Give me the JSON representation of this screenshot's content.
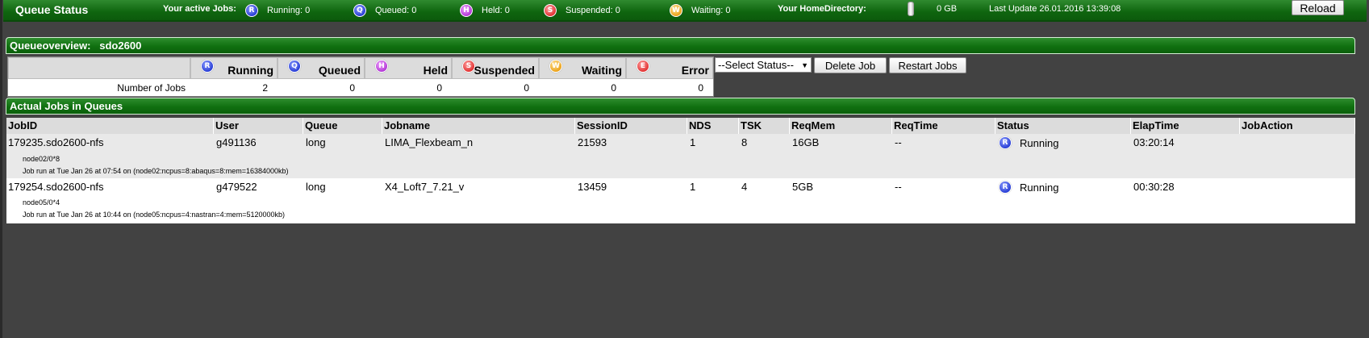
{
  "topbar": {
    "title": "Queue Status",
    "active_jobs_label": "Your active Jobs:",
    "counts": [
      {
        "badge": "R",
        "text": "Running: 0",
        "color": "#2a3fd6"
      },
      {
        "badge": "Q",
        "text": "Queued: 0",
        "color": "#2a3fd6"
      },
      {
        "badge": "H",
        "text": "Held: 0",
        "color": "#b43ad6"
      },
      {
        "badge": "S",
        "text": "Suspended: 0",
        "color": "#e23434"
      },
      {
        "badge": "W",
        "text": "Waiting: 0",
        "color": "#eba21a"
      }
    ],
    "home_dir_label": "Your HomeDirectory:",
    "home_dir_size": "0 GB",
    "last_update": "Last Update 26.01.2016 13:39:08",
    "reload_label": "Reload"
  },
  "overview": {
    "title": "Queueoverview:   sdo2600",
    "columns": [
      {
        "badge": "R",
        "label": "Running"
      },
      {
        "badge": "Q",
        "label": "Queued"
      },
      {
        "badge": "H",
        "label": "Held"
      },
      {
        "badge": "S",
        "label": "Suspended"
      },
      {
        "badge": "W",
        "label": "Waiting"
      },
      {
        "badge": "E",
        "label": "Error"
      }
    ],
    "row_label": "Number of Jobs",
    "values": [
      "2",
      "0",
      "0",
      "0",
      "0",
      "0"
    ],
    "select_value": "--Select Status--",
    "delete_label": "Delete Job",
    "restart_label": "Restart Jobs"
  },
  "jobs": {
    "title": "Actual Jobs in Queues",
    "headers": [
      "JobID",
      "User",
      "Queue",
      "Jobname",
      "SessionID",
      "NDS",
      "TSK",
      "ReqMem",
      "ReqTime",
      "Status",
      "ElapTime",
      "JobAction"
    ],
    "rows": [
      {
        "jobid": "179235.sdo2600-nfs",
        "user": "g491136",
        "queue": "long",
        "jobname": "LIMA_Flexbeam_n",
        "session": "21593",
        "nds": "1",
        "tsk": "8",
        "reqmem": "16GB",
        "reqtime": "--",
        "status_badge": "R",
        "status": "Running",
        "elap": "03:20:14",
        "detail1": "node02/0*8",
        "detail2": "Job run at Tue Jan 26 at 07:54 on (node02:ncpus=8:abaqus=8:mem=16384000kb)"
      },
      {
        "jobid": "179254.sdo2600-nfs",
        "user": "g479522",
        "queue": "long",
        "jobname": "X4_Loft7_7.21_v",
        "session": "13459",
        "nds": "1",
        "tsk": "4",
        "reqmem": "5GB",
        "reqtime": "--",
        "status_badge": "R",
        "status": "Running",
        "elap": "00:30:28",
        "detail1": "node05/0*4",
        "detail2": "Job run at Tue Jan 26 at 10:44 on (node05:ncpus=4:nastran=4:mem=5120000kb)"
      }
    ]
  }
}
